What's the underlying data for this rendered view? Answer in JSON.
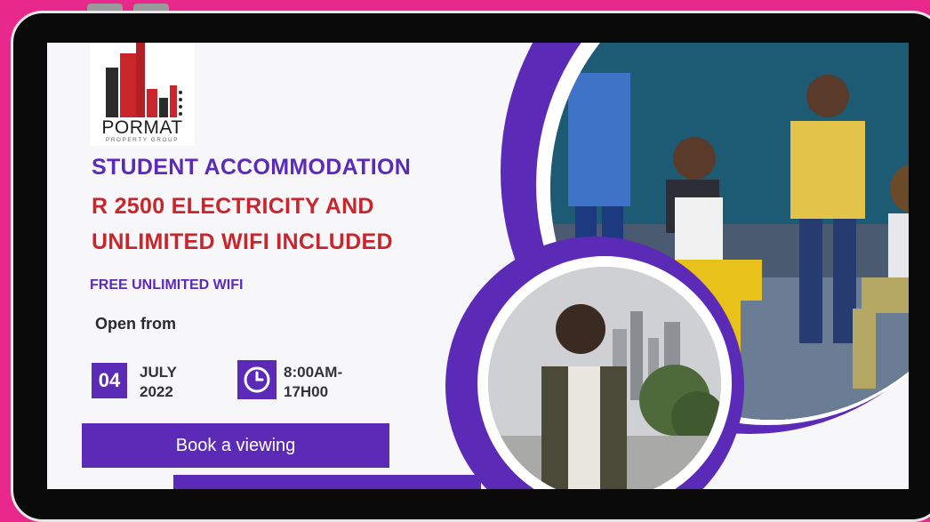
{
  "logo": {
    "brand": "PORMAT",
    "tagline": "PROPERTY GROUP"
  },
  "ad": {
    "title": "STUDENT ACCOMMODATION",
    "offer_line1": "R 2500 ELECTRICITY AND",
    "offer_line2": "UNLIMITED WIFI INCLUDED",
    "wifi": "FREE  UNLIMITED WIFI",
    "open_label": "Open from",
    "day": "04",
    "month": "JULY",
    "year": "2022",
    "time_start": "8:00AM-",
    "time_end": "17H00",
    "button_label": "Book a viewing"
  },
  "colors": {
    "accent": "#5b2bb8",
    "red": "#c8262c",
    "background": "#e8288a"
  },
  "icons": [
    "clock-icon"
  ]
}
